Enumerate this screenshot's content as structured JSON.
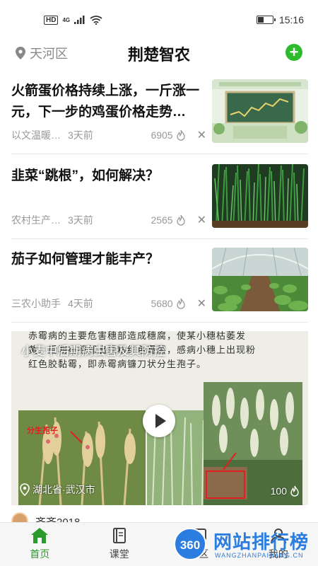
{
  "status_bar": {
    "hd": "HD",
    "network": "4G",
    "time": "15:16",
    "battery_level": 0.35
  },
  "header": {
    "location": "天河区",
    "title": "荆楚智农",
    "add_icon": "plus-circle-icon"
  },
  "news": [
    {
      "headline": "火箭蛋价格持续上涨，一斤涨一元，下一步的鸡蛋价格走势…",
      "source": "以文温暖…",
      "time": "3天前",
      "count": "6905"
    },
    {
      "headline": "韭菜“跳根”，如何解决？",
      "source": "农村生产…",
      "time": "3天前",
      "count": "2565"
    },
    {
      "headline": "茄子如何管理才能丰产？",
      "source": "三农小助手",
      "time": "4天前",
      "count": "5680"
    }
  ],
  "video": {
    "title": "小麦中后期病虫害及其防控",
    "text_line1": "赤霉病的主要危害穗部造成穗腐，使某小穗枯萎发",
    "text_line2": "黄，后期在穗部出现粉红色霉层，感病小穗上出现粉",
    "text_line3": "红色胶黏霉，即赤霉病镰刀状分生孢子。",
    "label": "分生孢子",
    "location": "湖北省·武汉市",
    "count": "100"
  },
  "peek": {
    "name": "齐齐2018"
  },
  "bottom_nav": [
    {
      "label": "首页",
      "icon": "home-icon",
      "active": true
    },
    {
      "label": "课堂",
      "icon": "book-icon",
      "active": false
    },
    {
      "label": "社区",
      "icon": "community-icon",
      "active": false
    },
    {
      "label": "我的",
      "icon": "profile-icon",
      "active": false
    }
  ],
  "watermark": {
    "badge": "360",
    "text": "网站排行榜",
    "url": "WANGZHANPAIHANG.CN"
  },
  "colors": {
    "accent": "#2dbb2d",
    "nav_active": "#2a9a2a",
    "watermark": "#2b7de0"
  }
}
